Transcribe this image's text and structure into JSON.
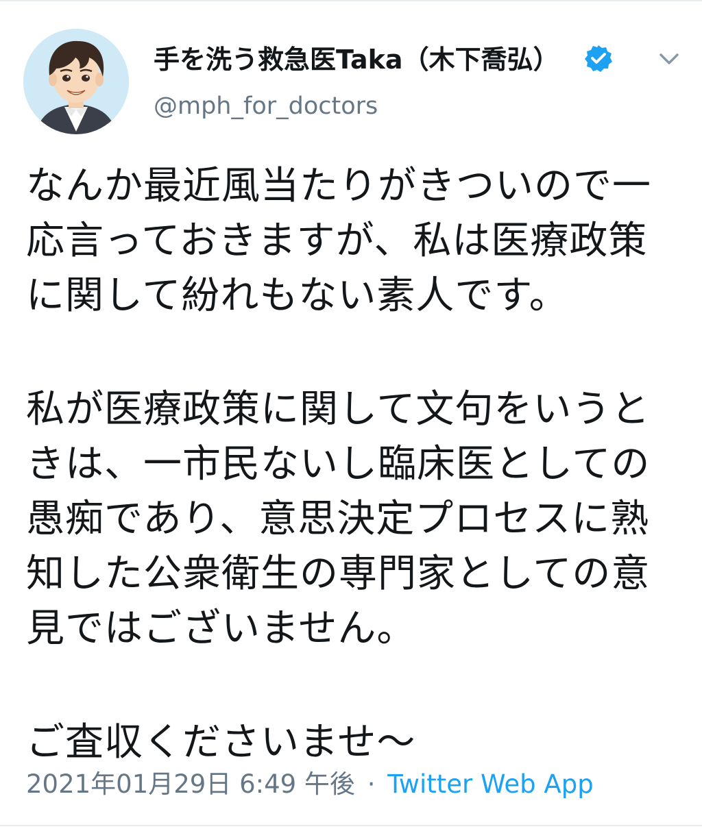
{
  "tweet": {
    "display_name": "手を洗う救急医Taka（木下喬弘）",
    "handle": "@mph_for_doctors",
    "icons": {
      "verified": "verified-badge-icon",
      "menu": "chevron-down-icon",
      "avatar": "avatar-illustration"
    },
    "colors": {
      "text": "#14171a",
      "secondary": "#657786",
      "link": "#1da1f2",
      "verified": "#1da1f2"
    },
    "paragraphs": [
      {
        "lines": [
          "なんか最近風当たりがきついので一",
          "応言っておきますが、私は医療政策",
          "に関して紛れもない素人です。"
        ]
      },
      {
        "lines": [
          "私が医療政策に関して文句をいうと",
          "きは、一市民ないし臨床医としての",
          "愚痴であり、意思決定プロセスに熟",
          "知した公衆衛生の専門家としての意",
          "見ではございません。"
        ]
      },
      {
        "lines": [
          "ご査収くださいませ〜"
        ]
      }
    ],
    "timestamp": "2021年01月29日 6:49 午後",
    "separator": "·",
    "source": "Twitter Web App"
  }
}
